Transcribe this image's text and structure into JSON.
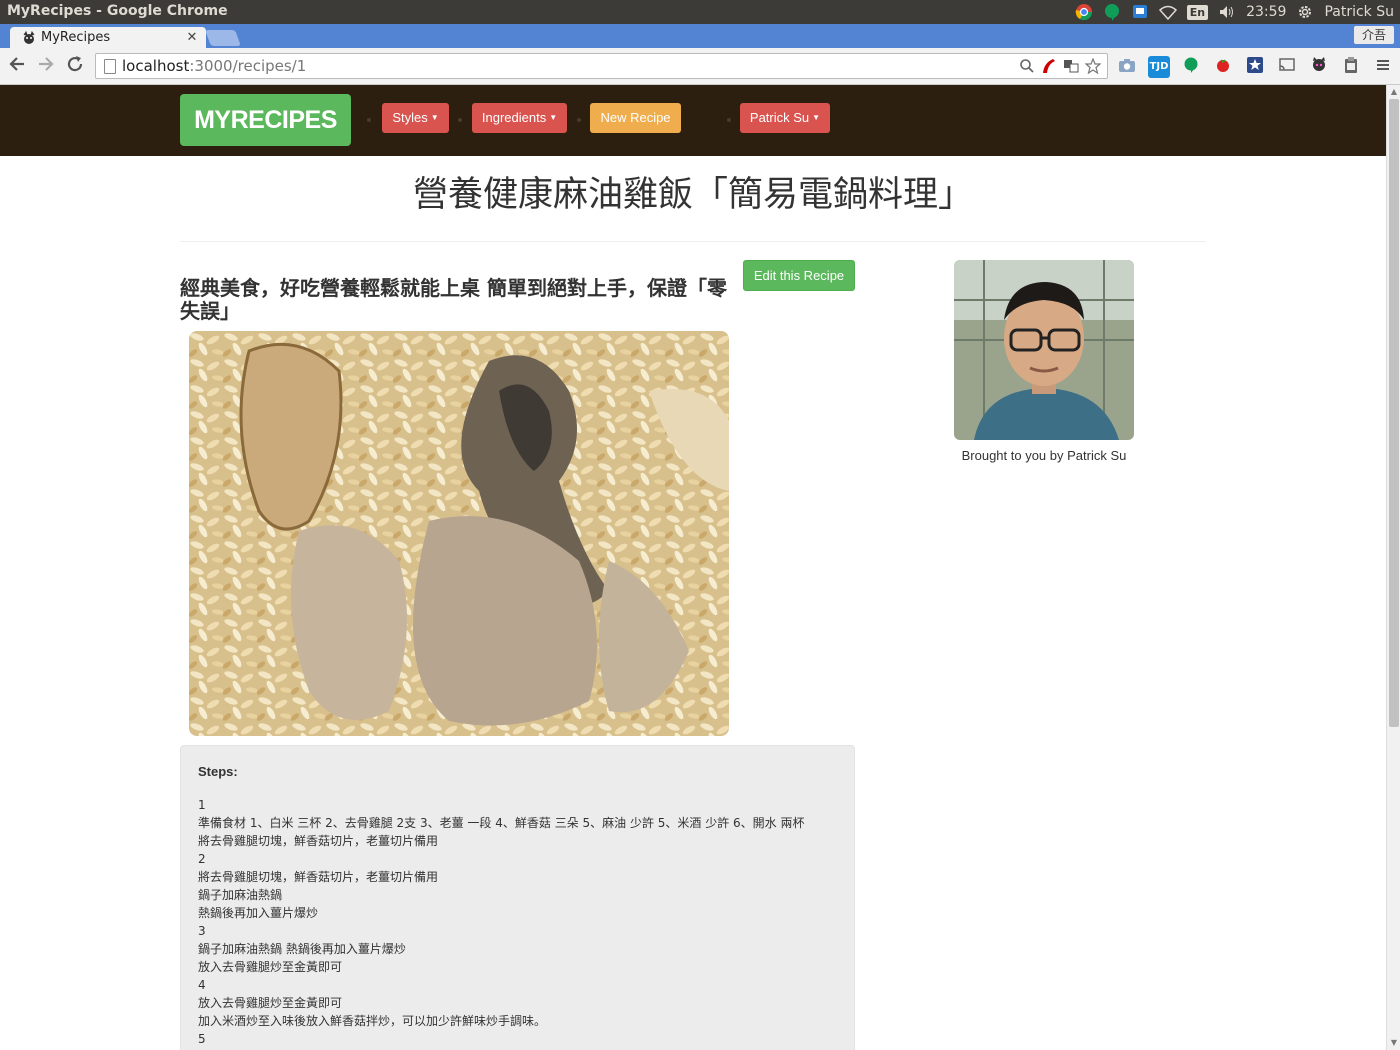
{
  "os": {
    "window_title": "MyRecipes - Google Chrome",
    "keyboard": "En",
    "time": "23:59",
    "user": "Patrick Su"
  },
  "browser": {
    "tab_title": "MyRecipes",
    "window_button": "介吾",
    "url_host": "localhost",
    "url_path": ":3000/recipes/1"
  },
  "navbar": {
    "brand": "MYRECIPES",
    "styles": "Styles",
    "ingredients": "Ingredients",
    "new_recipe": "New Recipe",
    "user_menu": "Patrick Su",
    "colors": {
      "brand": "#5cb85c",
      "danger": "#d9534f",
      "warning": "#f0ad4e",
      "bar": "#2c1f10"
    }
  },
  "recipe": {
    "title": "營養健康麻油雞飯「簡易電鍋料理」",
    "summary": "經典美食，好吃營養輕鬆就能上桌 簡單到絕對上手，保證「零失誤」",
    "edit_button": "Edit this Recipe",
    "author_caption": "Brought to you by Patrick Su",
    "steps_heading": "Steps:",
    "steps_lines": [
      "1",
      "準備食材 1、白米 三杯 2、去骨雞腿 2支 3、老薑 一段 4、鮮香菇 三朵 5、麻油 少許 5、米酒 少許 6、開水 兩杯",
      "將去骨雞腿切塊，鮮香菇切片，老薑切片備用",
      "2",
      "將去骨雞腿切塊，鮮香菇切片，老薑切片備用",
      "鍋子加麻油熱鍋",
      "熱鍋後再加入薑片爆炒",
      "3",
      "鍋子加麻油熱鍋 熱鍋後再加入薑片爆炒",
      "放入去骨雞腿炒至金黃即可",
      "4",
      "放入去骨雞腿炒至金黃即可",
      "加入米酒炒至入味後放入鮮香菇拌炒，可以加少許鮮味炒手調味。",
      "5",
      "加入米酒炒至入味後放入鮮香菇拌炒，可以加少許鮮味炒手調味。"
    ]
  }
}
